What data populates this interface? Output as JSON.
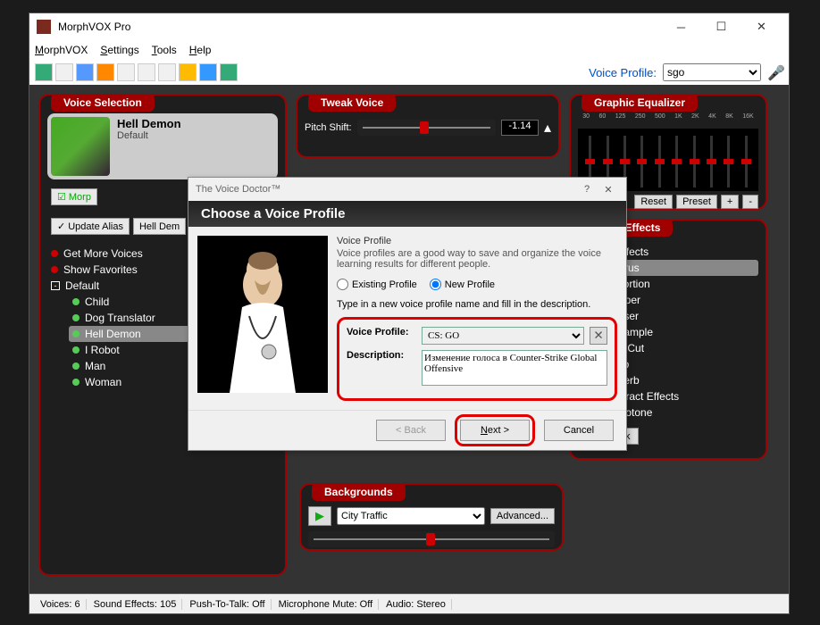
{
  "app": {
    "title": "MorphVOX Pro",
    "menu": {
      "morphvox": "MorphVOX",
      "settings": "Settings",
      "tools": "Tools",
      "help": "Help"
    },
    "voice_profile_label": "Voice Profile:",
    "voice_profile_value": "sgo"
  },
  "panels": {
    "voice_selection": {
      "title": "Voice Selection",
      "current_name": "Hell Demon",
      "current_sub": "Default",
      "morph_btn": "Morp",
      "update_alias": "Update Alias",
      "hell_dem_tab": "Hell Dem",
      "tree": {
        "get_more": "Get More Voices",
        "show_fav": "Show Favorites",
        "default": "Default",
        "items": [
          "Child",
          "Dog Translator",
          "Hell Demon",
          "I Robot",
          "Man",
          "Woman"
        ]
      }
    },
    "tweak_voice": {
      "title": "Tweak Voice",
      "pitch_label": "Pitch Shift:",
      "pitch_value": "-1.14"
    },
    "equalizer": {
      "title": "Graphic Equalizer",
      "bands": [
        "30",
        "60",
        "125",
        "250",
        "500",
        "1K",
        "2K",
        "4K",
        "8K",
        "16K"
      ],
      "buttons": {
        "reset": "Reset",
        "preset": "Preset",
        "plus": "+",
        "minus": "-"
      }
    },
    "voice_effects": {
      "title": "Voice Effects",
      "after_effects": "After Effects",
      "items": [
        "Chorus",
        "Distortion",
        "Gapper",
        "Phaser",
        "Resample",
        "Low Cut",
        "Echo",
        "Reverb"
      ],
      "vocal_tract": "Vocal Tract Effects",
      "monotone": "Monotone",
      "tweak_btn": "Tweak"
    },
    "backgrounds": {
      "title": "Backgrounds",
      "selected": "City Traffic",
      "advanced": "Advanced..."
    }
  },
  "dialog": {
    "title": "The Voice Doctor™",
    "header": "Choose a Voice Profile",
    "group_title": "Voice Profile",
    "desc": "Voice profiles are a good way to save and organize the voice learning results for different people.",
    "radio_existing": "Existing Profile",
    "radio_new": "New Profile",
    "instruction": "Type in a new voice profile name and fill in the description.",
    "profile_label": "Voice Profile:",
    "profile_value": "CS: GO",
    "desc_label": "Description:",
    "desc_value": "Изменение голоса в Counter-Strike Global Offensive",
    "back": "< Back",
    "next": "Next >",
    "cancel": "Cancel"
  },
  "status": {
    "voices": "Voices: 6",
    "sfx": "Sound Effects: 105",
    "ptt": "Push-To-Talk: Off",
    "mic": "Microphone Mute: Off",
    "audio": "Audio: Stereo"
  }
}
